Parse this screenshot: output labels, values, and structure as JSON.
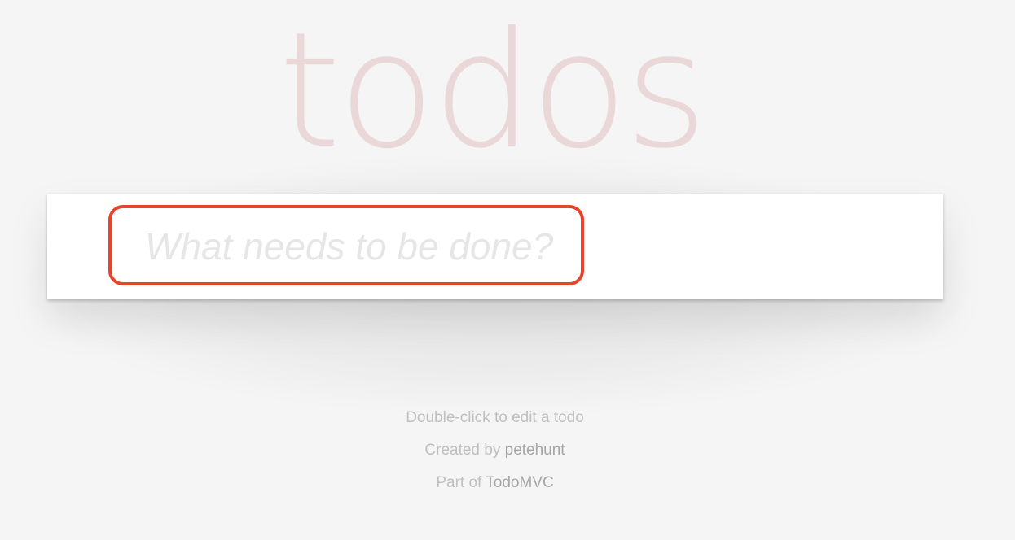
{
  "app": {
    "title": "todos"
  },
  "new_todo": {
    "value": "",
    "placeholder": "What needs to be done?"
  },
  "footer": {
    "hint": "Double-click to edit a todo",
    "created_prefix": "Created by",
    "author": "petehunt",
    "part_prefix": "Part of",
    "project": "TodoMVC"
  },
  "colors": {
    "background": "#f5f5f5",
    "title": "#ead7d7",
    "highlight": "#e8432b",
    "placeholder": "#e6e6e6",
    "footer_text": "#bfbfbf"
  }
}
